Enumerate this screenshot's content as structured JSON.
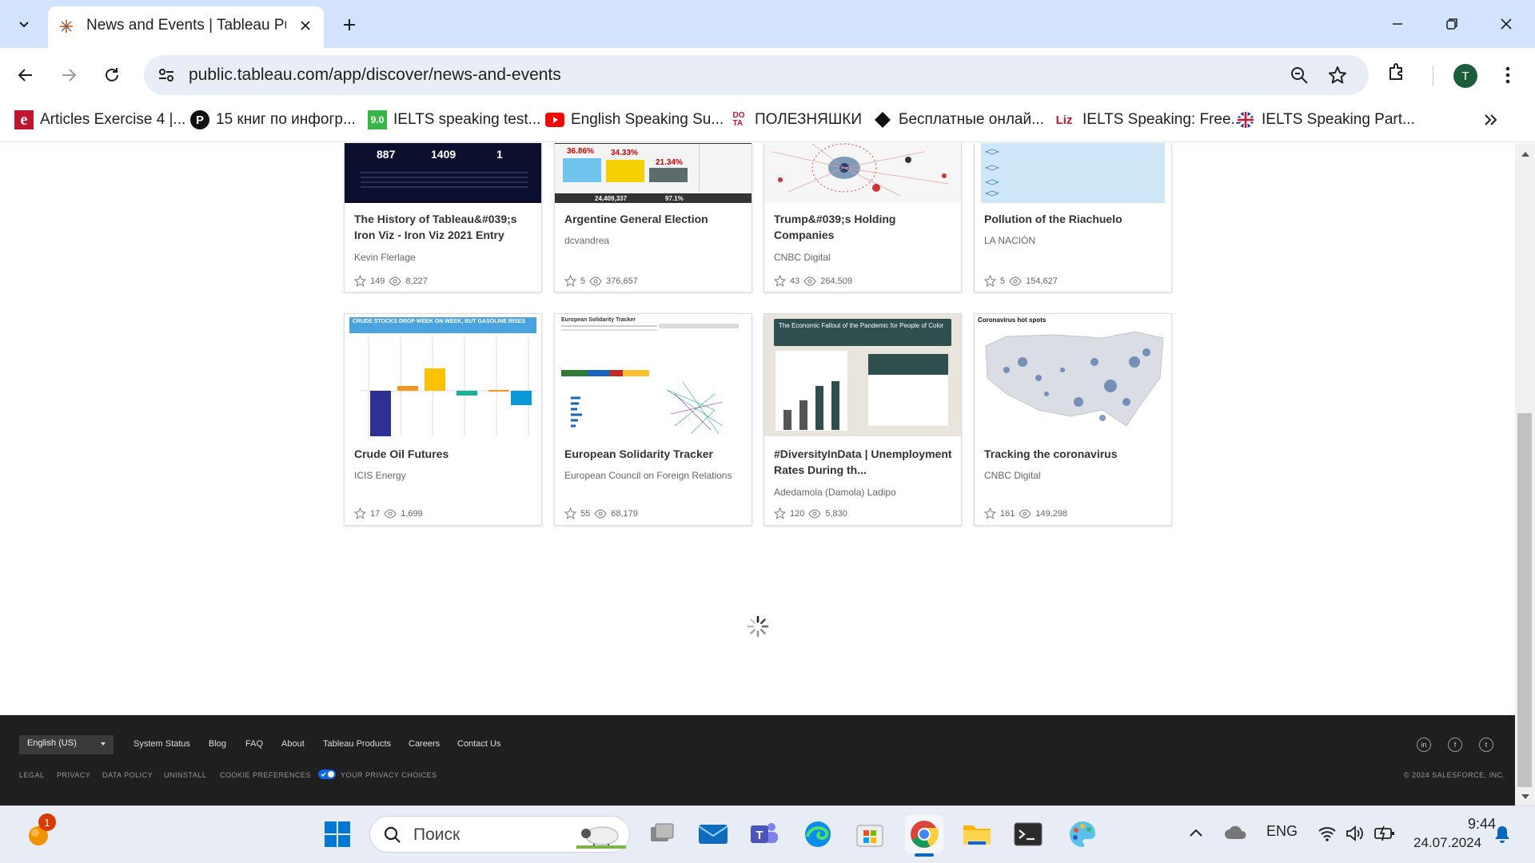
{
  "browser": {
    "tab_title": "News and Events | Tableau Publ",
    "url": "public.tableau.com/app/discover/news-and-events",
    "avatar_letter": "T"
  },
  "bookmarks": [
    {
      "label": "Articles Exercise 4 |...",
      "icon": "e"
    },
    {
      "label": "15 книг по инфогр...",
      "icon": "P"
    },
    {
      "label": "IELTS speaking test...",
      "icon": "9.0"
    },
    {
      "label": "English Speaking Su...",
      "icon": "youtube"
    },
    {
      "label": "ПОЛЕЗНЯШКИ",
      "icon": "DO TA"
    },
    {
      "label": "Бесплатные онлай...",
      "icon": "diamond"
    },
    {
      "label": "IELTS Speaking: Free...",
      "icon": "Liz"
    },
    {
      "label": "IELTS Speaking Part...",
      "icon": "uk-flag"
    }
  ],
  "cards_row1": [
    {
      "title": "The History of Tableau&#039;s Iron Viz - Iron Viz 2021 Entry",
      "author": "Kevin Flerlage",
      "favorites": "149",
      "views": "8,227",
      "thumb_numbers": [
        "887",
        "1409",
        "1"
      ]
    },
    {
      "title": "Argentine General Election",
      "author": "dcvandrea",
      "favorites": "5",
      "views": "376,657",
      "thumb_numbers": [
        "36.86%",
        "34.33%",
        "21.34%",
        "24,409,337",
        "97.1%"
      ]
    },
    {
      "title": "Trump&#039;s Holding Companies",
      "author": "CNBC Digital",
      "favorites": "43",
      "views": "264,509"
    },
    {
      "title": "Pollution of the Riachuelo",
      "author": "LA NACIÓN",
      "favorites": "5",
      "views": "154,627"
    }
  ],
  "cards_row2": [
    {
      "title": "Crude Oil Futures",
      "author": "ICIS Energy",
      "favorites": "17",
      "views": "1,699",
      "thumb_title": "CRUDE STOCKS DROP WEEK ON WEEK, BUT GASOLINE RISES"
    },
    {
      "title": "European Solidarity Tracker",
      "author": "European Council on Foreign Relations",
      "favorites": "55",
      "views": "68,179",
      "thumb_title": "European Solidarity Tracker"
    },
    {
      "title": "#DiversityInData | Unemployment Rates During th...",
      "author": "Adedamola (Damola) Ladipo",
      "favorites": "120",
      "views": "5,830",
      "thumb_title": "The Economic Fallout of the Pandemic for People of Color"
    },
    {
      "title": "Tracking the coronavirus",
      "author": "CNBC Digital",
      "favorites": "161",
      "views": "149,298",
      "thumb_title": "Coronavirus hot spots"
    }
  ],
  "footer": {
    "language": "English (US)",
    "links": [
      "System Status",
      "Blog",
      "FAQ",
      "About",
      "Tableau Products",
      "Careers",
      "Contact Us"
    ],
    "legal_links": [
      "LEGAL",
      "PRIVACY",
      "DATA POLICY",
      "UNINSTALL",
      "COOKIE PREFERENCES",
      "YOUR PRIVACY CHOICES"
    ],
    "copyright": "© 2024 SALESFORCE, INC.",
    "social": [
      "in",
      "f",
      "t"
    ]
  },
  "taskbar": {
    "search_placeholder": "Поиск",
    "notification_count": "1",
    "language": "ENG",
    "time": "9:44",
    "date": "24.07.2024"
  },
  "colors": {
    "tabbar": "#d3e3fd",
    "footer": "#1f1f1f",
    "tableau_blue": "#1f77b4"
  }
}
